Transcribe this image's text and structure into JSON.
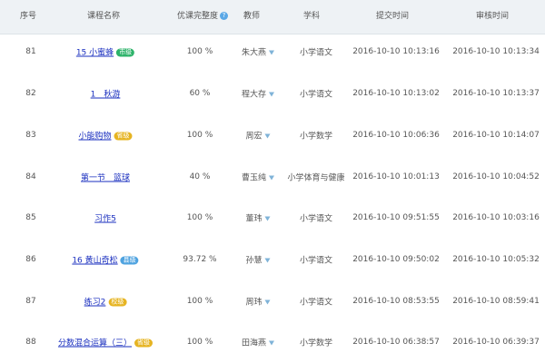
{
  "header": {
    "seq": "序号",
    "course": "课程名称",
    "completeness": "优课完整度",
    "teacher": "教师",
    "subject": "学科",
    "submit_time": "提交时间",
    "review_time": "审核时间"
  },
  "badge_colors": {
    "市级": "#2db36a",
    "省级": "#e6b422",
    "校级": "#e6b422",
    "县级": "#4fa3e0"
  },
  "rows": [
    {
      "seq": "81",
      "title": "15 小蜜蜂",
      "badge": "市级",
      "pct": "100 %",
      "teacher": "朱大燕",
      "filter": true,
      "subject": "小学语文",
      "submit": "2016-10-10 10:13:16",
      "review": "2016-10-10 10:13:34"
    },
    {
      "seq": "82",
      "title": "1　秋游",
      "badge": "",
      "pct": "60 %",
      "teacher": "程大存",
      "filter": true,
      "subject": "小学语文",
      "submit": "2016-10-10 10:13:02",
      "review": "2016-10-10 10:13:37"
    },
    {
      "seq": "83",
      "title": "小能购物",
      "badge": "省级",
      "pct": "100 %",
      "teacher": "周宏",
      "filter": true,
      "subject": "小学数学",
      "submit": "2016-10-10 10:06:36",
      "review": "2016-10-10 10:14:07"
    },
    {
      "seq": "84",
      "title": "第一节　篮球",
      "badge": "",
      "pct": "40 %",
      "teacher": "曹玉纯",
      "filter": true,
      "subject": "小学体育与健康",
      "submit": "2016-10-10 10:01:13",
      "review": "2016-10-10 10:04:52"
    },
    {
      "seq": "85",
      "title": "习作5",
      "badge": "",
      "pct": "100 %",
      "teacher": "董玮",
      "filter": true,
      "subject": "小学语文",
      "submit": "2016-10-10 09:51:55",
      "review": "2016-10-10 10:03:16"
    },
    {
      "seq": "86",
      "title": "16 黄山奇松",
      "badge": "县级",
      "pct": "93.72 %",
      "teacher": "孙慧",
      "filter": true,
      "subject": "小学语文",
      "submit": "2016-10-10 09:50:02",
      "review": "2016-10-10 10:05:32"
    },
    {
      "seq": "87",
      "title": "练习2",
      "badge": "校级",
      "pct": "100 %",
      "teacher": "周玮",
      "filter": true,
      "subject": "小学语文",
      "submit": "2016-10-10 08:53:55",
      "review": "2016-10-10 08:59:41"
    },
    {
      "seq": "88",
      "title": "分数混合运算（三）",
      "badge": "省级",
      "pct": "100 %",
      "teacher": "田海燕",
      "filter": true,
      "subject": "小学数学",
      "submit": "2016-10-10 06:38:57",
      "review": "2016-10-10 06:39:37"
    }
  ]
}
